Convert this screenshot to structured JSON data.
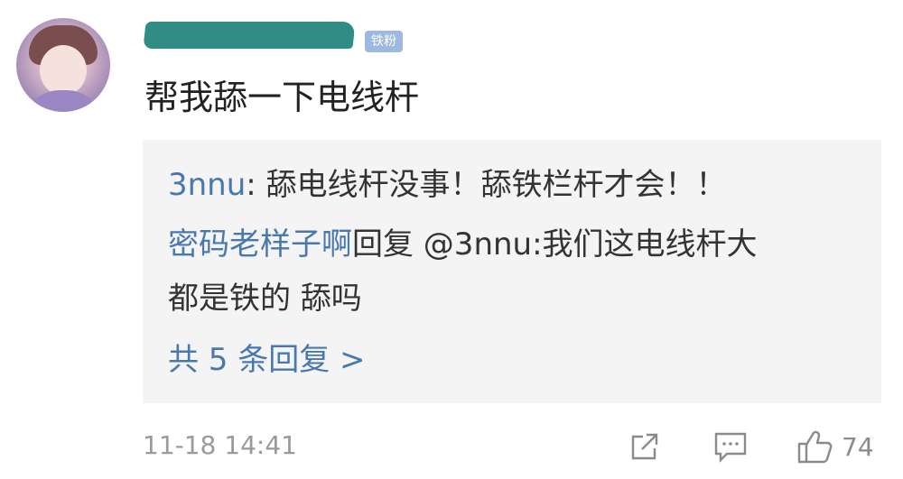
{
  "badge_label": "铁粉",
  "comment_text": "帮我舔一下电线杆",
  "replies": {
    "reply1": {
      "name": "3nnu",
      "text": ": 舔电线杆没事！舔铁栏杆才会！！"
    },
    "reply2": {
      "name": "密码老样子啊",
      "text_line1": "回复 @3nnu:我们这电线杆大",
      "text_line2": "都是铁的  舔吗"
    },
    "more_label": "共 5 条回复 >"
  },
  "footer": {
    "timestamp": "11-18 14:41",
    "like_count": "74"
  },
  "icons": {
    "share": "share-icon",
    "comment": "comment-icon",
    "like": "thumbs-up-icon"
  },
  "colors": {
    "link": "#4a78ad",
    "badge": "#9db9e0",
    "reply_bg": "#f4f4f4",
    "muted": "#9a9a9a"
  }
}
